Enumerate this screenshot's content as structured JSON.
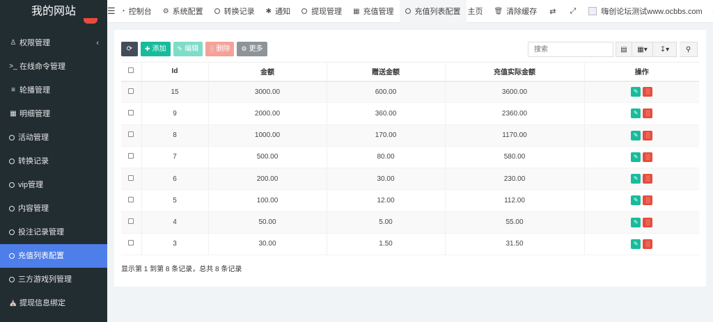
{
  "brand": "我的网站",
  "sidebar": {
    "items": [
      {
        "label": "权限管理",
        "icon": "users-icon"
      },
      {
        "label": "在线命令管理",
        "icon": "terminal-icon"
      },
      {
        "label": "轮播管理",
        "icon": "list-icon"
      },
      {
        "label": "明细管理",
        "icon": "calendar-icon"
      },
      {
        "label": "活动管理",
        "icon": "circle-icon"
      },
      {
        "label": "转换记录",
        "icon": "circle-icon"
      },
      {
        "label": "vip管理",
        "icon": "circle-icon"
      },
      {
        "label": "内容管理",
        "icon": "circle-icon"
      },
      {
        "label": "投注记录管理",
        "icon": "circle-icon"
      },
      {
        "label": "充值列表配置",
        "icon": "circle-icon"
      },
      {
        "label": "三方游戏列管理",
        "icon": "circle-icon"
      },
      {
        "label": "提现信息绑定",
        "icon": "bank-icon"
      }
    ]
  },
  "topbar": {
    "tabs": [
      {
        "label": "控制台",
        "icon": "dashboard-icon"
      },
      {
        "label": "系统配置",
        "icon": "gear-icon"
      },
      {
        "label": "转换记录",
        "icon": "circle-icon"
      },
      {
        "label": "通知",
        "icon": "asterisk-icon"
      },
      {
        "label": "提现管理",
        "icon": "circle-icon"
      },
      {
        "label": "充值管理",
        "icon": "grid-icon"
      },
      {
        "label": "充值列表配置",
        "icon": "circle-icon"
      }
    ],
    "home": "主页",
    "clear_cache": "清除缓存",
    "user": "嗨创论坛测试www.ocbbs.com"
  },
  "toolbar": {
    "add": "添加",
    "edit": "编辑",
    "delete": "删除",
    "more": "更多"
  },
  "search": {
    "placeholder": "搜索"
  },
  "table": {
    "headers": [
      "Id",
      "金额",
      "赠送金额",
      "充值实际金额",
      "操作"
    ],
    "rows": [
      [
        "15",
        "3000.00",
        "600.00",
        "3600.00"
      ],
      [
        "9",
        "2000.00",
        "360.00",
        "2360.00"
      ],
      [
        "8",
        "1000.00",
        "170.00",
        "1170.00"
      ],
      [
        "7",
        "500.00",
        "80.00",
        "580.00"
      ],
      [
        "6",
        "200.00",
        "30.00",
        "230.00"
      ],
      [
        "5",
        "100.00",
        "12.00",
        "112.00"
      ],
      [
        "4",
        "50.00",
        "5.00",
        "55.00"
      ],
      [
        "3",
        "30.00",
        "1.50",
        "31.50"
      ]
    ]
  },
  "pagination": {
    "info": "显示第 1 到第 8 条记录，总共 8 条记录"
  },
  "colors": {
    "sidebar": "#222d32",
    "active": "#4e7eea",
    "success": "#18bc9c",
    "danger": "#e74c3c"
  }
}
